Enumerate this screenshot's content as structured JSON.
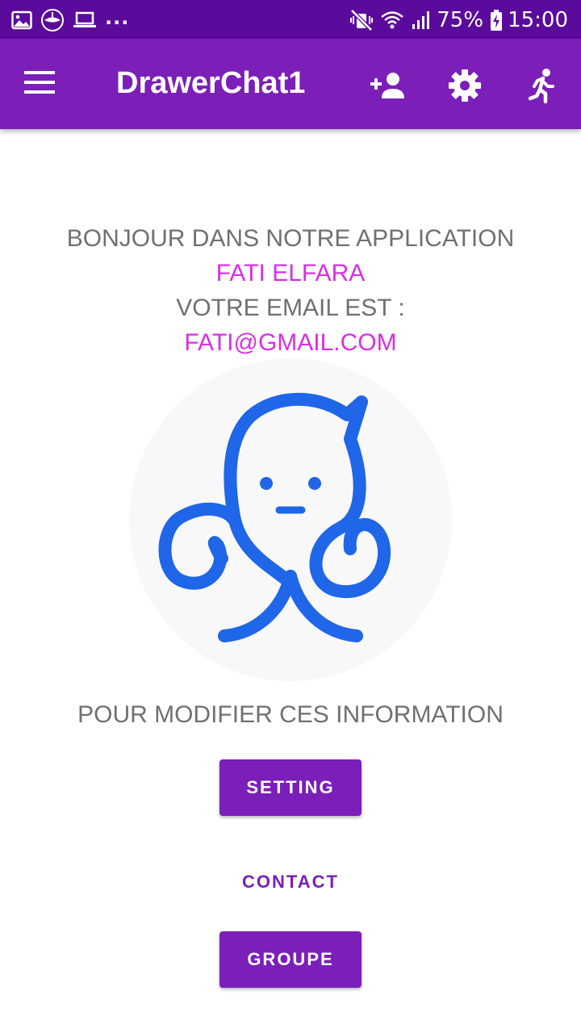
{
  "status_bar": {
    "more_indicator": "...",
    "battery_percent": "75%",
    "time": "15:00",
    "notification_icons": [
      "gallery-icon",
      "app-logo-icon",
      "laptop-icon"
    ],
    "system_icons": [
      "mute-vibrate-icon",
      "wifi-icon",
      "signal-icon",
      "battery-charging-icon"
    ]
  },
  "app_bar": {
    "title": "DrawerChat1",
    "actions": [
      "add-person-icon",
      "settings-gear-icon",
      "running-person-icon"
    ]
  },
  "welcome": {
    "greeting": "BONJOUR DANS NOTRE APPLICATION",
    "user_name": "FATI ELFARA",
    "email_label": "VOTRE EMAIL EST :",
    "email": "FATI@GMAIL.COM"
  },
  "logo": {
    "icon": "octopus-chat-logo"
  },
  "modify_text": "POUR MODIFIER CES INFORMATION",
  "buttons": {
    "setting": "SETTING",
    "contact": "CONTACT",
    "groupe": "GROUPE"
  },
  "colors": {
    "status_bar": "#5b0b9c",
    "app_bar": "#7b1fb8",
    "accent_text": "#d92ee6",
    "grey_text": "#707070",
    "logo_blue": "#1f66e8",
    "logo_bg": "#f8f8f8"
  }
}
